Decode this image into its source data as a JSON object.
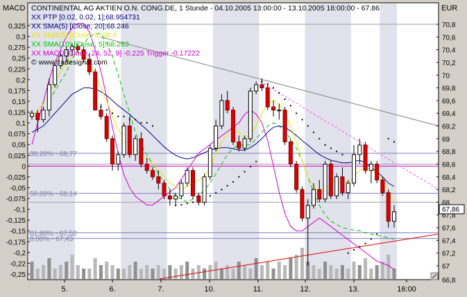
{
  "chart_data": {
    "type": "candlestick",
    "title": "CONTINENTAL AG AKTIEN O.N. CONG.DE, 1 Stunde - 04.10.2005 13:00:00 - 13.10.2005 18:00:00 - 67.86",
    "left_axis_label": "MACD",
    "right_axis_label": "EUR",
    "price_tag": "67,86",
    "left_ticks": [
      "0,325",
      "0,3",
      "0,275",
      "0,25",
      "0,225",
      "0,2",
      "0,175",
      "0,15",
      "0,125",
      "0,1",
      "0,075",
      "0,05",
      "0,025",
      "0",
      "-0,025",
      "-0,05",
      "-0,075",
      "-0,1",
      "-0,125",
      "-0,15",
      "-0,175",
      "-0,2",
      "-0,22",
      "-0,25"
    ],
    "right_ticks": [
      "70,8",
      "70,6",
      "70,4",
      "70,2",
      "70",
      "69,8",
      "69,6",
      "69,4",
      "69,2",
      "69",
      "68,8",
      "68,6",
      "68,4",
      "68,2",
      "68",
      "67,8",
      "67,6",
      "67,4",
      "67,2",
      "67"
    ],
    "right_bottom_label": "66,8",
    "x_ticks": [
      "5.",
      "6.",
      "7.",
      "10.",
      "11.",
      "12.",
      "13.",
      "16:00"
    ],
    "legend": [
      {
        "text": "CONTINENTAL AG AKTIEN O.N. CONG.DE, 1 Stunde - 04.10.2005 13:00:00 - 13.10.2005 18:00:00 - 67.86",
        "color": "#000000"
      },
      {
        "text": "XX PTP [0.02, 0.02, 1];68.954731",
        "color": "#000080"
      },
      {
        "text": "XX SMA(5) [Close, 20];68.246",
        "color": "#000080"
      },
      {
        "text": "XX SMA(5) [Close, 9];68.8",
        "color": "#e6e600"
      },
      {
        "text": "XX SMA(10) [Close, 5];68.263",
        "color": "#00c000"
      },
      {
        "text": "XX MACD [Close, 24, 52, 9] -0.225 Trigger -0.17222",
        "color": "#d000d0"
      },
      {
        "text": "© www.tradesignal.com",
        "color": "#000000"
      }
    ],
    "fib_levels": [
      {
        "label": "38,20% - 68,77",
        "price": 68.77
      },
      {
        "label": "50,00% - 68,14",
        "price": 68.14
      },
      {
        "label": "61,80% - 67,52",
        "price": 67.52
      },
      {
        "label": "0,00% - 67,43",
        "price": 67.43
      }
    ],
    "candles": [
      {
        "o": 69.35,
        "h": 69.45,
        "l": 69.3,
        "c": 69.4
      },
      {
        "o": 69.4,
        "h": 69.45,
        "l": 69.1,
        "c": 69.3
      },
      {
        "o": 69.3,
        "h": 69.5,
        "l": 69.25,
        "c": 69.45
      },
      {
        "o": 69.45,
        "h": 69.95,
        "l": 69.35,
        "c": 69.85
      },
      {
        "o": 69.85,
        "h": 70.2,
        "l": 69.8,
        "c": 70.15
      },
      {
        "o": 70.15,
        "h": 70.35,
        "l": 70.1,
        "c": 70.3
      },
      {
        "o": 70.3,
        "h": 70.45,
        "l": 70.2,
        "c": 70.4
      },
      {
        "o": 70.4,
        "h": 70.5,
        "l": 70.3,
        "c": 70.45
      },
      {
        "o": 70.45,
        "h": 70.5,
        "l": 70.35,
        "c": 70.4
      },
      {
        "o": 70.4,
        "h": 70.45,
        "l": 70.2,
        "c": 70.25
      },
      {
        "o": 70.25,
        "h": 70.35,
        "l": 70.0,
        "c": 70.05
      },
      {
        "o": 70.05,
        "h": 70.1,
        "l": 69.45,
        "c": 69.45
      },
      {
        "o": 69.45,
        "h": 69.55,
        "l": 69.3,
        "c": 69.35
      },
      {
        "o": 69.35,
        "h": 69.4,
        "l": 68.95,
        "c": 69.0
      },
      {
        "o": 69.0,
        "h": 69.05,
        "l": 68.5,
        "c": 68.6
      },
      {
        "o": 68.6,
        "h": 68.8,
        "l": 68.5,
        "c": 68.75
      },
      {
        "o": 68.75,
        "h": 69.25,
        "l": 68.7,
        "c": 69.2
      },
      {
        "o": 69.2,
        "h": 69.35,
        "l": 68.7,
        "c": 68.75
      },
      {
        "o": 68.75,
        "h": 69.05,
        "l": 68.65,
        "c": 69.0
      },
      {
        "o": 69.0,
        "h": 69.1,
        "l": 68.55,
        "c": 68.6
      },
      {
        "o": 68.6,
        "h": 68.7,
        "l": 68.45,
        "c": 68.5
      },
      {
        "o": 68.5,
        "h": 68.55,
        "l": 68.35,
        "c": 68.4
      },
      {
        "o": 68.4,
        "h": 68.5,
        "l": 68.2,
        "c": 68.3
      },
      {
        "o": 68.3,
        "h": 68.35,
        "l": 68.05,
        "c": 68.1
      },
      {
        "o": 68.1,
        "h": 68.2,
        "l": 67.95,
        "c": 68.05
      },
      {
        "o": 68.05,
        "h": 68.15,
        "l": 67.95,
        "c": 68.1
      },
      {
        "o": 68.1,
        "h": 68.35,
        "l": 68.05,
        "c": 68.3
      },
      {
        "o": 68.3,
        "h": 68.55,
        "l": 68.25,
        "c": 68.5
      },
      {
        "o": 68.5,
        "h": 68.55,
        "l": 68.05,
        "c": 68.1
      },
      {
        "o": 68.1,
        "h": 68.15,
        "l": 67.95,
        "c": 68.0
      },
      {
        "o": 68.0,
        "h": 68.45,
        "l": 67.95,
        "c": 68.4
      },
      {
        "o": 68.4,
        "h": 68.9,
        "l": 68.35,
        "c": 68.85
      },
      {
        "o": 68.85,
        "h": 69.3,
        "l": 68.8,
        "c": 69.2
      },
      {
        "o": 69.2,
        "h": 69.7,
        "l": 69.15,
        "c": 69.6
      },
      {
        "o": 69.6,
        "h": 69.75,
        "l": 69.4,
        "c": 69.45
      },
      {
        "o": 69.45,
        "h": 69.5,
        "l": 68.9,
        "c": 68.95
      },
      {
        "o": 68.95,
        "h": 69.05,
        "l": 68.8,
        "c": 68.85
      },
      {
        "o": 68.85,
        "h": 69.05,
        "l": 68.8,
        "c": 69.0
      },
      {
        "o": 69.0,
        "h": 69.8,
        "l": 68.95,
        "c": 69.75
      },
      {
        "o": 69.75,
        "h": 69.9,
        "l": 69.7,
        "c": 69.85
      },
      {
        "o": 69.85,
        "h": 69.95,
        "l": 69.75,
        "c": 69.8
      },
      {
        "o": 69.8,
        "h": 69.85,
        "l": 69.45,
        "c": 69.5
      },
      {
        "o": 69.5,
        "h": 69.6,
        "l": 69.35,
        "c": 69.45
      },
      {
        "o": 69.45,
        "h": 69.55,
        "l": 69.3,
        "c": 69.45
      },
      {
        "o": 69.45,
        "h": 69.5,
        "l": 68.9,
        "c": 68.95
      },
      {
        "o": 68.95,
        "h": 69.0,
        "l": 68.55,
        "c": 68.6
      },
      {
        "o": 68.6,
        "h": 68.65,
        "l": 68.15,
        "c": 68.2
      },
      {
        "o": 68.2,
        "h": 68.25,
        "l": 67.7,
        "c": 67.75
      },
      {
        "o": 67.75,
        "h": 68.05,
        "l": 67.0,
        "c": 67.95
      },
      {
        "o": 67.95,
        "h": 68.3,
        "l": 67.9,
        "c": 68.2
      },
      {
        "o": 68.2,
        "h": 68.35,
        "l": 68.0,
        "c": 68.05
      },
      {
        "o": 68.05,
        "h": 68.65,
        "l": 68.0,
        "c": 68.6
      },
      {
        "o": 68.6,
        "h": 68.65,
        "l": 68.05,
        "c": 68.1
      },
      {
        "o": 68.1,
        "h": 68.45,
        "l": 68.05,
        "c": 68.4
      },
      {
        "o": 68.4,
        "h": 68.55,
        "l": 68.1,
        "c": 68.15
      },
      {
        "o": 68.15,
        "h": 68.35,
        "l": 68.05,
        "c": 68.3
      },
      {
        "o": 68.3,
        "h": 68.9,
        "l": 68.25,
        "c": 68.75
      },
      {
        "o": 68.75,
        "h": 69.0,
        "l": 68.6,
        "c": 68.9
      },
      {
        "o": 68.9,
        "h": 68.95,
        "l": 68.45,
        "c": 68.5
      },
      {
        "o": 68.5,
        "h": 68.65,
        "l": 68.3,
        "c": 68.6
      },
      {
        "o": 68.6,
        "h": 68.65,
        "l": 68.3,
        "c": 68.35
      },
      {
        "o": 68.35,
        "h": 68.4,
        "l": 68.1,
        "c": 68.15
      },
      {
        "o": 68.15,
        "h": 68.2,
        "l": 67.6,
        "c": 67.7
      },
      {
        "o": 67.7,
        "h": 67.95,
        "l": 67.6,
        "c": 67.85
      }
    ],
    "volume": [
      5,
      3,
      4,
      6,
      3,
      4,
      5,
      7,
      4,
      3,
      3,
      6,
      4,
      5,
      4,
      3,
      3,
      4,
      5,
      3,
      4,
      3,
      4,
      3,
      4,
      3,
      4,
      5,
      3,
      4,
      3,
      4,
      5,
      3,
      4,
      3,
      5,
      4,
      3,
      6,
      4,
      5,
      3,
      5,
      4,
      6,
      7,
      9,
      5,
      4,
      3,
      5,
      4,
      3,
      4,
      3,
      5,
      4,
      6,
      3,
      4,
      5,
      7,
      3
    ],
    "ptp": [
      null,
      null,
      null,
      null,
      null,
      null,
      null,
      null,
      null,
      null,
      null,
      null,
      69.5,
      69.45,
      69.4,
      69.35,
      69.35,
      69.3,
      69.3,
      69.25,
      69.25,
      69.2,
      null,
      null,
      null,
      67.95,
      67.96,
      67.98,
      68.0,
      68.03,
      68.06,
      68.1,
      68.15,
      68.2,
      68.26,
      68.32,
      68.4,
      68.48,
      68.56,
      68.64,
      69.9,
      69.86,
      69.8,
      69.72,
      69.62,
      69.52,
      69.4,
      69.3,
      69.2,
      69.1,
      69.0,
      68.9,
      68.85,
      68.8,
      68.75,
      67.2,
      67.25,
      67.3,
      67.35,
      67.42,
      67.5,
      null,
      69.0,
      68.95
    ],
    "sma_blue": [
      69.1,
      69.15,
      69.2,
      69.3,
      69.4,
      69.5,
      69.6,
      69.7,
      69.75,
      69.8,
      69.8,
      69.78,
      69.74,
      69.68,
      69.6,
      69.52,
      69.45,
      69.38,
      69.3,
      69.22,
      69.14,
      69.05,
      68.96,
      68.87,
      68.8,
      68.74,
      68.7,
      68.68,
      68.7,
      68.74,
      68.78,
      68.82,
      68.84,
      68.86,
      68.86,
      68.84,
      68.82,
      68.82,
      68.86,
      68.92,
      69.0,
      69.1,
      69.18,
      69.2,
      69.18,
      69.12,
      69.05,
      68.97,
      68.9,
      68.82,
      68.75,
      68.7,
      68.66,
      68.64,
      68.62,
      68.62,
      68.64,
      68.66,
      68.62,
      68.55,
      68.48,
      68.4,
      68.3,
      68.25
    ],
    "sma_yellow": [
      69.35,
      69.45,
      69.55,
      69.7,
      69.9,
      70.05,
      70.2,
      70.3,
      70.35,
      70.3,
      70.2,
      70.0,
      69.8,
      69.6,
      69.35,
      69.15,
      69.0,
      68.9,
      68.8,
      68.75,
      68.7,
      68.6,
      68.5,
      68.4,
      68.3,
      68.25,
      68.2,
      68.25,
      68.3,
      68.35,
      68.4,
      68.55,
      68.75,
      68.95,
      69.1,
      69.15,
      69.1,
      69.0,
      69.05,
      69.2,
      69.4,
      69.55,
      69.6,
      69.55,
      69.4,
      69.2,
      68.95,
      68.65,
      68.4,
      68.25,
      68.15,
      68.2,
      68.3,
      68.35,
      68.35,
      68.3,
      68.4,
      68.5,
      68.55,
      68.5,
      68.45,
      68.35,
      68.2,
      68.0
    ],
    "sma_green": [
      null,
      null,
      null,
      69.6,
      69.75,
      69.9,
      70.05,
      70.25,
      70.4,
      70.5,
      70.6,
      70.65,
      70.65,
      70.5,
      70.3,
      70.0,
      69.7,
      69.4,
      69.1,
      68.9,
      68.75,
      68.6,
      68.45,
      68.3,
      68.2,
      68.1,
      68.05,
      68.0,
      68.05,
      68.1,
      68.2,
      68.3,
      68.45,
      68.6,
      68.75,
      68.85,
      68.9,
      68.9,
      68.9,
      69.0,
      69.1,
      69.2,
      69.25,
      69.2,
      69.1,
      69.0,
      68.85,
      68.65,
      68.4,
      68.15,
      67.95,
      67.8,
      67.7,
      67.65,
      67.6,
      67.58,
      67.56,
      67.55,
      67.52,
      67.5,
      67.48,
      67.46,
      67.44,
      67.42
    ],
    "macd": [
      0.05,
      0.1,
      0.15,
      0.2,
      0.24,
      0.27,
      0.3,
      0.32,
      0.33,
      0.33,
      0.31,
      0.27,
      0.22,
      0.16,
      0.09,
      0.03,
      -0.02,
      -0.05,
      -0.07,
      -0.08,
      -0.09,
      -0.09,
      -0.08,
      -0.07,
      -0.06,
      -0.05,
      -0.03,
      -0.01,
      0.01,
      0.03,
      0.04,
      0.05,
      0.06,
      0.07,
      0.08,
      0.09,
      0.1,
      0.12,
      0.13,
      0.12,
      0.1,
      0.06,
      0.0,
      -0.06,
      -0.11,
      -0.14,
      -0.15,
      -0.15,
      -0.14,
      -0.13,
      -0.12,
      -0.13,
      -0.14,
      -0.15,
      -0.16,
      -0.17,
      -0.18,
      -0.19,
      -0.2,
      -0.21,
      -0.22,
      -0.225,
      -0.23,
      -0.24
    ]
  }
}
